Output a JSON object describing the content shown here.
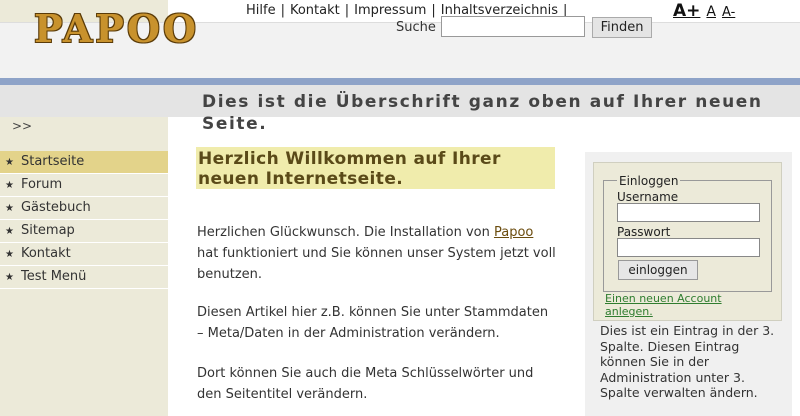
{
  "topnav": {
    "links": [
      "Hilfe",
      "Kontakt",
      "Impressum",
      "Inhaltsverzeichnis"
    ],
    "separator": "|"
  },
  "fontsize": {
    "large": "A+",
    "normal": "A",
    "small": "A-"
  },
  "header": {
    "logo": "PAPOO",
    "search_label": "Suche",
    "search_value": "",
    "search_button": "Finden"
  },
  "page": {
    "heading": "Dies ist die Überschrift ganz oben auf Ihrer neuen Seite."
  },
  "sidebar": {
    "toggle": ">>",
    "items": [
      {
        "label": "Startseite",
        "active": true
      },
      {
        "label": "Forum"
      },
      {
        "label": "Gästebuch"
      },
      {
        "label": "Sitemap"
      },
      {
        "label": "Kontakt"
      },
      {
        "label": "Test Menü"
      }
    ]
  },
  "main": {
    "welcome": "Herzlich Willkommen auf Ihrer neuen Internetseite.",
    "p1_before": "Herzlichen Glückwunsch. Die Installation von ",
    "p1_link": "Papoo",
    "p1_after": " hat funktioniert und Sie können unser System jetzt voll benutzen.",
    "p2": "Diesen Artikel hier z.B. können Sie unter Stammdaten – Meta/Daten in der Administration verändern.",
    "p3": "Dort können Sie auch die Meta Schlüsselwörter und den Seitentitel verändern."
  },
  "login": {
    "legend": "Einloggen",
    "username_label": "Username",
    "password_label": "Passwort",
    "button": "einloggen",
    "register_link": "Einen neuen Account anlegen."
  },
  "right_text": "Dies ist ein Eintrag in der 3. Spalte. Diesen Eintrag können Sie in der Administration unter 3. Spalte verwalten ändern.",
  "colors": {
    "accent_blue": "#8ea3c8",
    "menu_active": "#e3d38a",
    "welcome_bg": "#f0ecac",
    "sidebar_bg": "#ecead9"
  }
}
